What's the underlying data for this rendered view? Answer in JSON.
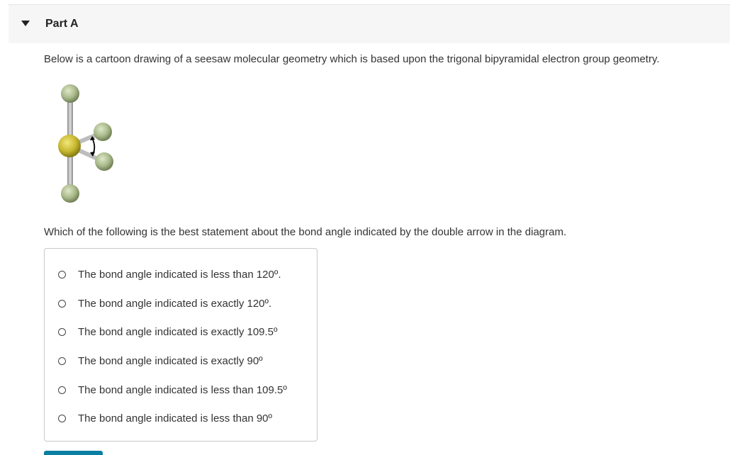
{
  "part": {
    "title": "Part A"
  },
  "intro_text": "Below is a cartoon drawing of a seesaw  molecular geometry which is based upon the trigonal bipyramidal electron group geometry.",
  "question_text": "Which of the following is the best statement about the bond angle indicated by the double arrow in the diagram.",
  "choices": [
    {
      "label": "The bond angle indicated is less than 120º."
    },
    {
      "label": "The bond angle indicated is exactly 120º."
    },
    {
      "label": "The bond angle indicated is exactly 109.5º"
    },
    {
      "label": "The bond angle indicated is exactly 90º"
    },
    {
      "label": "The bond angle indicated is less than 109.5º"
    },
    {
      "label": "The bond angle indicated is less than 90º"
    }
  ],
  "colors": {
    "central_atom": "#c7b830",
    "outer_atom": "#a9b98a",
    "bond": "#bfbfbf",
    "submit_button": "#0a7ea3"
  },
  "icons": {
    "caret": "caret-down-icon",
    "radio": "radio-unchecked-icon"
  }
}
